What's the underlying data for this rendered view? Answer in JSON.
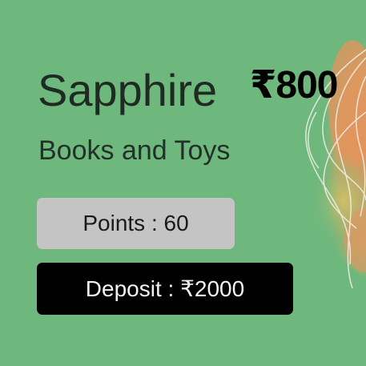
{
  "card": {
    "title": "Sapphire",
    "price": "₹800",
    "subtitle": "Books and Toys",
    "points_label": "Points : 60",
    "deposit_label": "Deposit : ₹2000"
  },
  "colors": {
    "background": "#6fb87d",
    "points_badge": "#c4c4c4",
    "deposit_button": "#000000",
    "decor_orange": "#e89a58",
    "decor_yellow": "#cfc466"
  }
}
